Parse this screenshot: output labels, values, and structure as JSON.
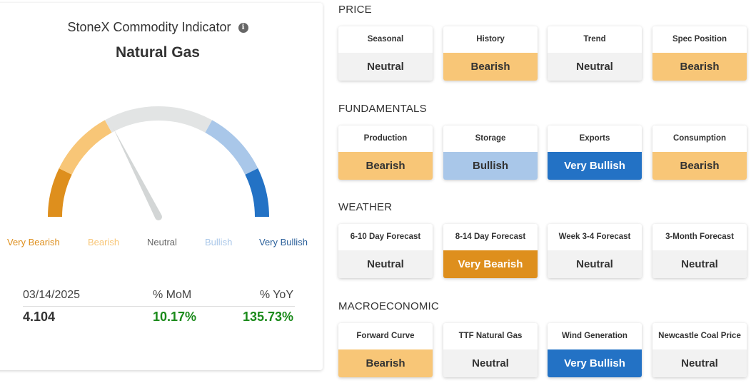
{
  "indicator": {
    "title": "StoneX Commodity Indicator",
    "info_icon": "info-icon",
    "commodity": "Natural Gas",
    "gauge": {
      "level": "Neutral",
      "needle_value": -0.3,
      "scale": [
        "Very Bearish",
        "Bearish",
        "Neutral",
        "Bullish",
        "Very Bullish"
      ],
      "colors": {
        "very_bearish": "#de8f1d",
        "bearish": "#f8c677",
        "neutral": "#e2e4e4",
        "bullish": "#a9c7e9",
        "very_bullish": "#2372c5",
        "needle": "#d3d6d6"
      }
    },
    "stats": {
      "date": "03/14/2025",
      "mom_label": "% MoM",
      "yoy_label": "% YoY",
      "price": "4.104",
      "mom": "10.17%",
      "yoy": "135.73%",
      "positive_color": "#1a8a1a"
    }
  },
  "sections": [
    {
      "title": "PRICE",
      "tiles": [
        {
          "label": "Seasonal",
          "value": "Neutral",
          "level": "neutral"
        },
        {
          "label": "History",
          "value": "Bearish",
          "level": "bearish"
        },
        {
          "label": "Trend",
          "value": "Neutral",
          "level": "neutral"
        },
        {
          "label": "Spec Position",
          "value": "Bearish",
          "level": "bearish"
        }
      ]
    },
    {
      "title": "FUNDAMENTALS",
      "tiles": [
        {
          "label": "Production",
          "value": "Bearish",
          "level": "bearish"
        },
        {
          "label": "Storage",
          "value": "Bullish",
          "level": "bullish"
        },
        {
          "label": "Exports",
          "value": "Very Bullish",
          "level": "vbullish"
        },
        {
          "label": "Consumption",
          "value": "Bearish",
          "level": "bearish"
        }
      ]
    },
    {
      "title": "WEATHER",
      "tiles": [
        {
          "label": "6-10 Day Forecast",
          "value": "Neutral",
          "level": "neutral"
        },
        {
          "label": "8-14 Day Forecast",
          "value": "Very Bearish",
          "level": "vbearish"
        },
        {
          "label": "Week 3-4 Forecast",
          "value": "Neutral",
          "level": "neutral"
        },
        {
          "label": "3-Month Forecast",
          "value": "Neutral",
          "level": "neutral"
        }
      ]
    },
    {
      "title": "MACROECONOMIC",
      "tiles": [
        {
          "label": "Forward Curve",
          "value": "Bearish",
          "level": "bearish"
        },
        {
          "label": "TTF Natural Gas",
          "value": "Neutral",
          "level": "neutral"
        },
        {
          "label": "Wind Generation",
          "value": "Very Bullish",
          "level": "vbullish"
        },
        {
          "label": "Newcastle Coal Price",
          "value": "Neutral",
          "level": "neutral"
        }
      ]
    }
  ]
}
